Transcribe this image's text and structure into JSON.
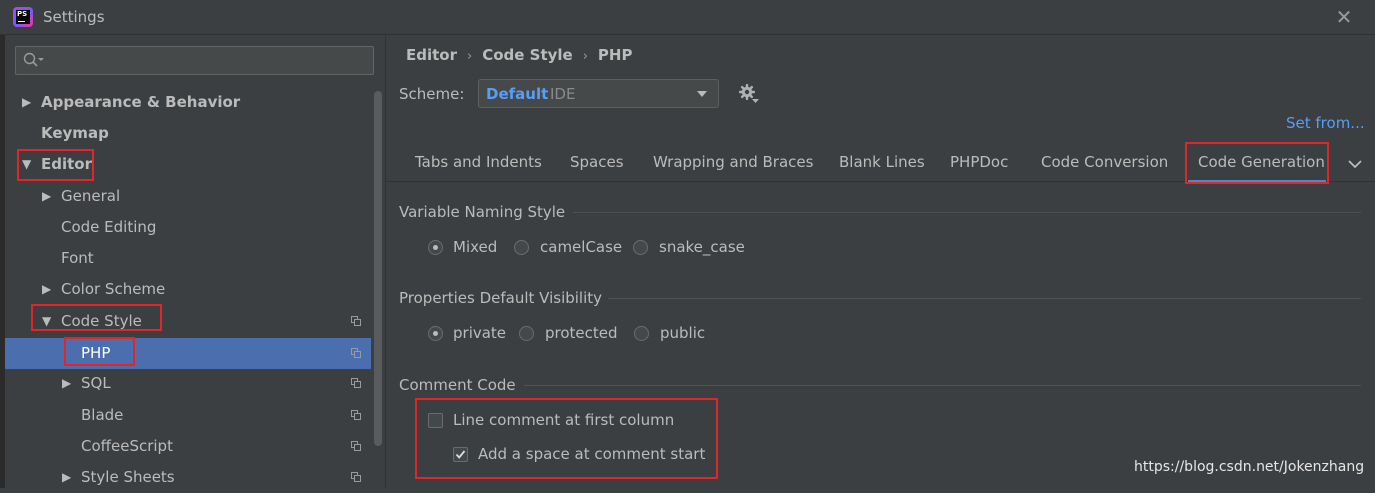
{
  "window": {
    "title": "Settings",
    "app_icon_text": "PS"
  },
  "sidebar": {
    "search_placeholder": "",
    "items": [
      {
        "label": "Appearance & Behavior",
        "bold": true
      },
      {
        "label": "Keymap",
        "bold": true
      },
      {
        "label": "Editor",
        "bold": true
      },
      {
        "label": "General"
      },
      {
        "label": "Code Editing"
      },
      {
        "label": "Font"
      },
      {
        "label": "Color Scheme"
      },
      {
        "label": "Code Style"
      },
      {
        "label": "PHP",
        "selected": true
      },
      {
        "label": "SQL"
      },
      {
        "label": "Blade"
      },
      {
        "label": "CoffeeScript"
      },
      {
        "label": "Style Sheets"
      }
    ]
  },
  "breadcrumb": {
    "part1": "Editor",
    "part2": "Code Style",
    "part3": "PHP"
  },
  "scheme": {
    "label": "Scheme:",
    "name": "Default",
    "kind": "IDE"
  },
  "set_from": "Set from...",
  "tabs": [
    "Tabs and Indents",
    "Spaces",
    "Wrapping and Braces",
    "Blank Lines",
    "PHPDoc",
    "Code Conversion",
    "Code Generation"
  ],
  "active_tab": "Code Generation",
  "variable_naming": {
    "title": "Variable Naming Style",
    "options": [
      "Mixed",
      "camelCase",
      "snake_case"
    ],
    "selected": "Mixed"
  },
  "visibility": {
    "title": "Properties Default Visibility",
    "options": [
      "private",
      "protected",
      "public"
    ],
    "selected": "private"
  },
  "comment_code": {
    "title": "Comment Code",
    "line_comment": {
      "label": "Line comment at first column",
      "checked": false
    },
    "add_space": {
      "label": "Add a space at comment start",
      "checked": true
    }
  },
  "watermark": "https://blog.csdn.net/Jokenzhang",
  "colors": {
    "accent": "#4b6eaf",
    "link": "#589df6",
    "highlight": "#e2252b",
    "background": "#3c3f41"
  }
}
